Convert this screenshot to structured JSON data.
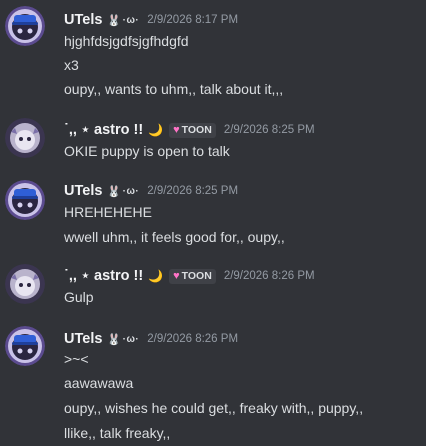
{
  "messages": [
    {
      "author": "UTels",
      "tag": "·ω·",
      "timestamp": "2/9/2026 8:17 PM",
      "lines": [
        "hjghfdsjgdfsjgfhdgfd",
        "x3",
        "oupy,, wants to uhm,, talk about it,,,"
      ]
    },
    {
      "author": "˙,, ⋆ astro !!",
      "role": "TOON",
      "timestamp": "2/9/2026 8:25 PM",
      "lines": [
        "OKIE puppy is open to talk"
      ]
    },
    {
      "author": "UTels",
      "tag": "·ω·",
      "timestamp": "2/9/2026 8:25 PM",
      "lines": [
        "HREHEHEHE",
        "wwell uhm,, it feels good for,, oupy,,"
      ]
    },
    {
      "author": "˙,, ⋆ astro !!",
      "role": "TOON",
      "timestamp": "2/9/2026 8:26 PM",
      "lines": [
        "Gulp"
      ]
    },
    {
      "author": "UTels",
      "tag": "·ω·",
      "timestamp": "2/9/2026 8:26 PM",
      "lines": [
        ">~<",
        "aawawawa",
        "oupy,, wishes he could get,, freaky with,, puppy,,",
        "llike,, talk freaky,,"
      ]
    }
  ],
  "colors": {
    "background": "#313338",
    "username": "#f2f3f5",
    "text": "#dbdee1",
    "timestamp": "#949ba4",
    "role_heart": "#ff73c7"
  },
  "icons": {
    "tag_icon": "bunny-icon",
    "moon": "crescent-moon-icon",
    "role_heart": "heart-icon"
  }
}
